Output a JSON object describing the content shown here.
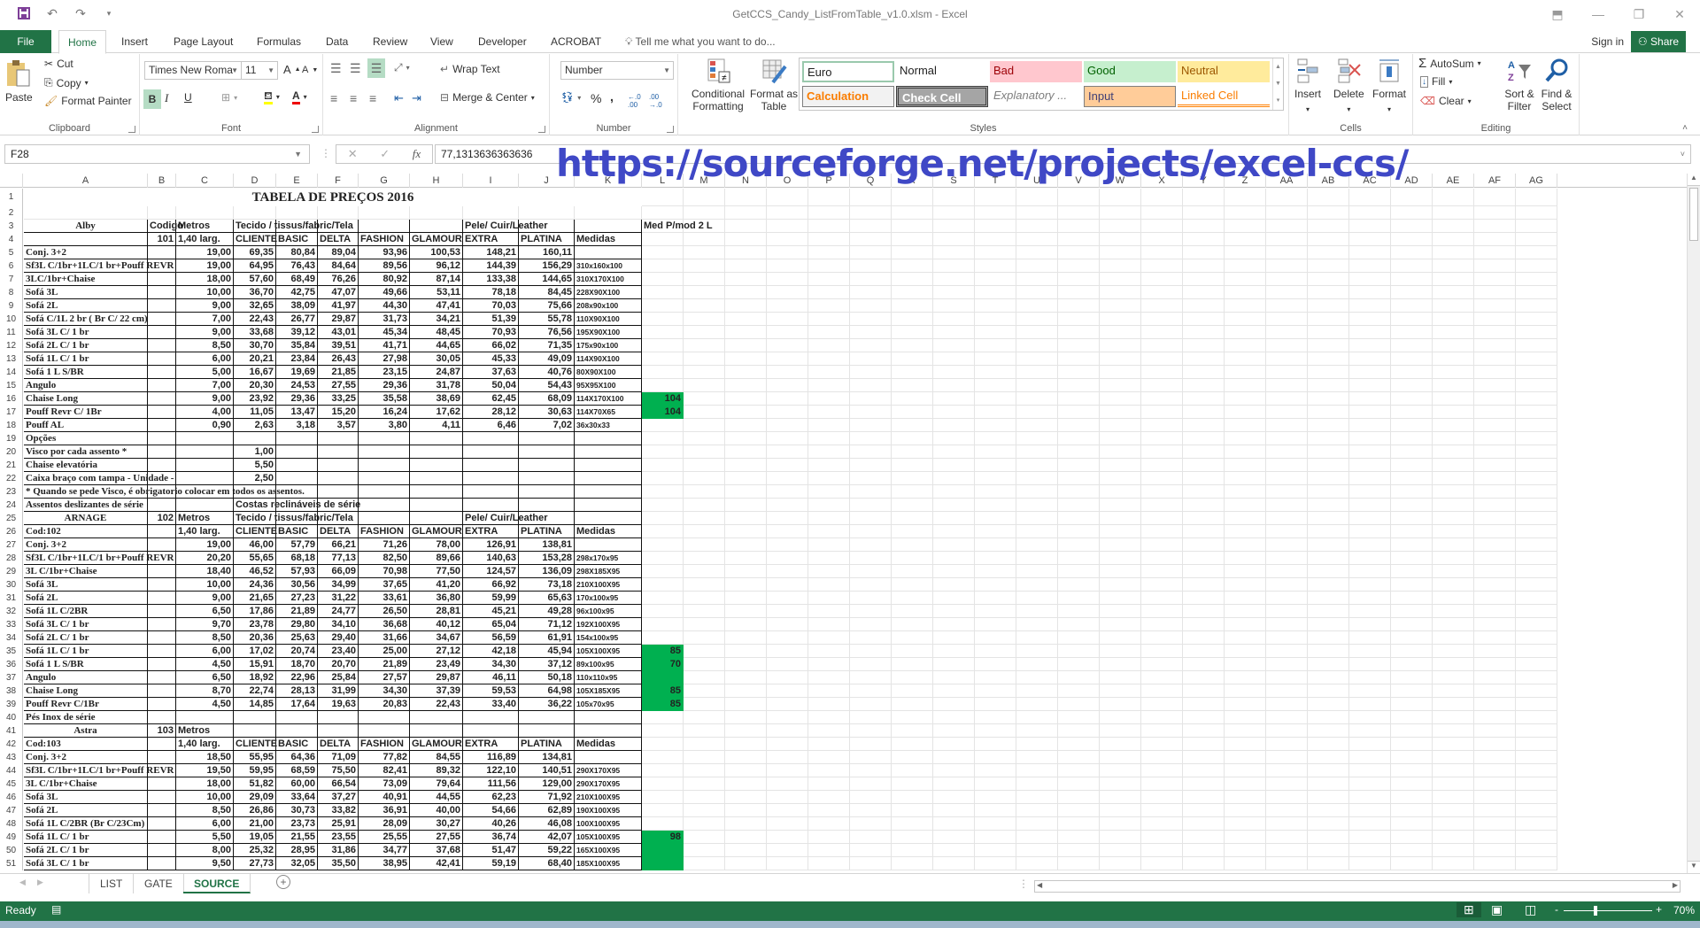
{
  "window": {
    "title": "GetCCS_Candy_ListFromTable_v1.0.xlsm - Excel",
    "controls": [
      "ribbon-display",
      "minimize",
      "restore",
      "close"
    ]
  },
  "ribbon_tabs": [
    {
      "label": "File"
    },
    {
      "label": "Home",
      "active": true
    },
    {
      "label": "Insert"
    },
    {
      "label": "Page Layout"
    },
    {
      "label": "Formulas"
    },
    {
      "label": "Data"
    },
    {
      "label": "Review"
    },
    {
      "label": "View"
    },
    {
      "label": "Developer"
    },
    {
      "label": "ACROBAT"
    }
  ],
  "tell_me": "Tell me what you want to do...",
  "sign_in": "Sign in",
  "share": "Share",
  "clipboard": {
    "paste": "Paste",
    "cut": "Cut",
    "copy": "Copy",
    "format_painter": "Format Painter",
    "label": "Clipboard"
  },
  "font": {
    "name": "Times New Roma",
    "size": "11",
    "bold": "B",
    "italic": "I",
    "underline": "U",
    "label": "Font",
    "grow": "A",
    "shrink": "A"
  },
  "alignment": {
    "wrap_text": "Wrap Text",
    "merge_center": "Merge & Center",
    "label": "Alignment"
  },
  "number": {
    "format": "Number",
    "percent": "%",
    "comma": ",",
    "label": "Number"
  },
  "styles": {
    "conditional_formatting": "Conditional Formatting",
    "format_as_table": "Format as Table",
    "cells": [
      {
        "label": "Euro",
        "bg": "#ffffff",
        "fg": "#000000",
        "border": "#9ac9ad"
      },
      {
        "label": "Normal",
        "bg": "#ffffff",
        "fg": "#000000"
      },
      {
        "label": "Bad",
        "bg": "#ffc7ce",
        "fg": "#9c0006"
      },
      {
        "label": "Good",
        "bg": "#c6efce",
        "fg": "#006100"
      },
      {
        "label": "Neutral",
        "bg": "#ffeb9c",
        "fg": "#9c5700"
      },
      {
        "label": "Calculation",
        "bg": "#f2f2f2",
        "fg": "#fa7d00",
        "border": "#7f7f7f"
      },
      {
        "label": "Check Cell",
        "bg": "#a5a5a5",
        "fg": "#ffffff",
        "border": "#3f3f3f"
      },
      {
        "label": "Explanatory ...",
        "bg": "#ffffff",
        "fg": "#7f7f7f"
      },
      {
        "label": "Input",
        "bg": "#ffcc99",
        "fg": "#3f3f76",
        "border": "#7f7f7f"
      },
      {
        "label": "Linked Cell",
        "bg": "#ffffff",
        "fg": "#fa7d00"
      }
    ],
    "label": "Styles"
  },
  "cells_group": {
    "insert": "Insert",
    "delete": "Delete",
    "format": "Format",
    "label": "Cells"
  },
  "editing": {
    "autosum": "AutoSum",
    "fill": "Fill",
    "clear": "Clear",
    "sort_filter": "Sort & Filter",
    "find_select": "Find & Select",
    "label": "Editing"
  },
  "formula_bar": {
    "name_box": "F28",
    "value": "77,1313636363636",
    "cancel": "✕",
    "enter": "✓",
    "fx": "fx"
  },
  "overlay_url": "https://sourceforge.net/projects/excel-ccs/",
  "columns": [
    "A",
    "B",
    "C",
    "D",
    "E",
    "F",
    "G",
    "H",
    "I",
    "J",
    "K",
    "L",
    "M",
    "N",
    "O",
    "P",
    "Q",
    "R",
    "S",
    "T",
    "U",
    "V",
    "W",
    "X",
    "Y",
    "Z",
    "AA",
    "AB",
    "AC",
    "AD",
    "AE",
    "AF",
    "AG"
  ],
  "sheet": {
    "title": "TABELA DE PREÇOS 2016",
    "rows": [
      {
        "r": 1
      },
      {
        "r": 2
      },
      {
        "r": 3,
        "A": "Alby",
        "B": "Codigo",
        "C": "Metros",
        "D": "Tecido / tissus/fabric/Tela",
        "I": "Pele/ Cuir/Leather",
        "L": "Med P/mod 2 L"
      },
      {
        "r": 4,
        "B": "101",
        "C": "1,40 larg.",
        "D": "CLIENTE",
        "E": "BASIC",
        "F": "DELTA",
        "G": "FASHION",
        "H": "GLAMOUR",
        "I": "EXTRA",
        "J": "PLATINA",
        "K": "Medidas"
      },
      {
        "r": 5,
        "A": "Conj. 3+2",
        "C": "19,00",
        "D": "69,35",
        "E": "80,84",
        "F": "89,04",
        "G": "93,96",
        "H": "100,53",
        "I": "148,21",
        "J": "160,11"
      },
      {
        "r": 6,
        "A": "Sf3L C/1br+1LC/1 br+Pouff REVR",
        "C": "19,00",
        "D": "64,95",
        "E": "76,43",
        "F": "84,64",
        "G": "89,56",
        "H": "96,12",
        "I": "144,39",
        "J": "156,29",
        "K": "310x160x100"
      },
      {
        "r": 7,
        "A": "3LC/1br+Chaise",
        "C": "18,00",
        "D": "57,60",
        "E": "68,49",
        "F": "76,26",
        "G": "80,92",
        "H": "87,14",
        "I": "133,38",
        "J": "144,65",
        "K": "310X170X100"
      },
      {
        "r": 8,
        "A": "Sofá 3L",
        "C": "10,00",
        "D": "36,70",
        "E": "42,75",
        "F": "47,07",
        "G": "49,66",
        "H": "53,11",
        "I": "78,18",
        "J": "84,45",
        "K": "228X90X100"
      },
      {
        "r": 9,
        "A": "Sofá 2L",
        "C": "9,00",
        "D": "32,65",
        "E": "38,09",
        "F": "41,97",
        "G": "44,30",
        "H": "47,41",
        "I": "70,03",
        "J": "75,66",
        "K": "208x90x100"
      },
      {
        "r": 10,
        "A": "Sofá C/1L 2 br ( Br C/ 22 cm)",
        "C": "7,00",
        "D": "22,43",
        "E": "26,77",
        "F": "29,87",
        "G": "31,73",
        "H": "34,21",
        "I": "51,39",
        "J": "55,78",
        "K": "110X90X100"
      },
      {
        "r": 11,
        "A": "Sofá 3L C/ 1 br",
        "C": "9,00",
        "D": "33,68",
        "E": "39,12",
        "F": "43,01",
        "G": "45,34",
        "H": "48,45",
        "I": "70,93",
        "J": "76,56",
        "K": "195X90X100"
      },
      {
        "r": 12,
        "A": "Sofá 2L C/ 1 br",
        "C": "8,50",
        "D": "30,70",
        "E": "35,84",
        "F": "39,51",
        "G": "41,71",
        "H": "44,65",
        "I": "66,02",
        "J": "71,35",
        "K": "175x90x100"
      },
      {
        "r": 13,
        "A": "Sofá 1L C/ 1 br",
        "C": "6,00",
        "D": "20,21",
        "E": "23,84",
        "F": "26,43",
        "G": "27,98",
        "H": "30,05",
        "I": "45,33",
        "J": "49,09",
        "K": "114X90X100"
      },
      {
        "r": 14,
        "A": "Sofá 1 L S/BR",
        "C": "5,00",
        "D": "16,67",
        "E": "19,69",
        "F": "21,85",
        "G": "23,15",
        "H": "24,87",
        "I": "37,63",
        "J": "40,76",
        "K": "80X90X100"
      },
      {
        "r": 15,
        "A": "Angulo",
        "C": "7,00",
        "D": "20,30",
        "E": "24,53",
        "F": "27,55",
        "G": "29,36",
        "H": "31,78",
        "I": "50,04",
        "J": "54,43",
        "K": "95X95X100"
      },
      {
        "r": 16,
        "A": "Chaise Long",
        "C": "9,00",
        "D": "23,92",
        "E": "29,36",
        "F": "33,25",
        "G": "35,58",
        "H": "38,69",
        "I": "62,45",
        "J": "68,09",
        "K": "114X170X100",
        "L": "104"
      },
      {
        "r": 17,
        "A": "Pouff Revr C/ 1Br",
        "C": "4,00",
        "D": "11,05",
        "E": "13,47",
        "F": "15,20",
        "G": "16,24",
        "H": "17,62",
        "I": "28,12",
        "J": "30,63",
        "K": "114X70X65",
        "L": "104"
      },
      {
        "r": 18,
        "A": "Pouff AL",
        "C": "0,90",
        "D": "2,63",
        "E": "3,18",
        "F": "3,57",
        "G": "3,80",
        "H": "4,11",
        "I": "6,46",
        "J": "7,02",
        "K": "36x30x33"
      },
      {
        "r": 19,
        "A": "Opções"
      },
      {
        "r": 20,
        "A": "Visco por cada assento *",
        "D": "1,00"
      },
      {
        "r": 21,
        "A": "Chaise elevatória",
        "D": "5,50"
      },
      {
        "r": 22,
        "A": "Caixa braço com tampa - Unidade -",
        "D": "2,50"
      },
      {
        "r": 23,
        "A": "* Quando se pede Visco, é obrigatorio colocar em todos os assentos."
      },
      {
        "r": 24,
        "A": "Assentos deslizantes de série",
        "D": "Costas reclináveis de série"
      },
      {
        "r": 25,
        "A": "ARNAGE",
        "B": "102",
        "C": "Metros",
        "D": "Tecido / tissus/fabric/Tela",
        "I": "Pele/ Cuir/Leather"
      },
      {
        "r": 26,
        "A": "Cod:102",
        "C": "1,40 larg.",
        "D": "CLIENTE",
        "E": "BASIC",
        "F": "DELTA",
        "G": "FASHION",
        "H": "GLAMOUR",
        "I": "EXTRA",
        "J": "PLATINA",
        "K": "Medidas"
      },
      {
        "r": 27,
        "A": "Conj. 3+2",
        "C": "19,00",
        "D": "46,00",
        "E": "57,79",
        "F": "66,21",
        "G": "71,26",
        "H": "78,00",
        "I": "126,91",
        "J": "138,81"
      },
      {
        "r": 28,
        "A": "Sf3L C/1br+1LC/1 br+Pouff REVR",
        "C": "20,20",
        "D": "55,65",
        "E": "68,18",
        "F": "77,13",
        "G": "82,50",
        "H": "89,66",
        "I": "140,63",
        "J": "153,28",
        "K": "298x170x95"
      },
      {
        "r": 29,
        "A": "3L C/1br+Chaise",
        "C": "18,40",
        "D": "46,52",
        "E": "57,93",
        "F": "66,09",
        "G": "70,98",
        "H": "77,50",
        "I": "124,57",
        "J": "136,09",
        "K": "298X185X95"
      },
      {
        "r": 30,
        "A": "Sofá 3L",
        "C": "10,00",
        "D": "24,36",
        "E": "30,56",
        "F": "34,99",
        "G": "37,65",
        "H": "41,20",
        "I": "66,92",
        "J": "73,18",
        "K": "210X100X95"
      },
      {
        "r": 31,
        "A": "Sofá 2L",
        "C": "9,00",
        "D": "21,65",
        "E": "27,23",
        "F": "31,22",
        "G": "33,61",
        "H": "36,80",
        "I": "59,99",
        "J": "65,63",
        "K": "170x100x95"
      },
      {
        "r": 32,
        "A": "Sofá 1L C/2BR",
        "C": "6,50",
        "D": "17,86",
        "E": "21,89",
        "F": "24,77",
        "G": "26,50",
        "H": "28,81",
        "I": "45,21",
        "J": "49,28",
        "K": "96x100x95"
      },
      {
        "r": 33,
        "A": "Sofá 3L C/ 1 br",
        "C": "9,70",
        "D": "23,78",
        "E": "29,80",
        "F": "34,10",
        "G": "36,68",
        "H": "40,12",
        "I": "65,04",
        "J": "71,12",
        "K": "192X100X95"
      },
      {
        "r": 34,
        "A": "Sofá 2L C/ 1 br",
        "C": "8,50",
        "D": "20,36",
        "E": "25,63",
        "F": "29,40",
        "G": "31,66",
        "H": "34,67",
        "I": "56,59",
        "J": "61,91",
        "K": "154x100x95"
      },
      {
        "r": 35,
        "A": "Sofá 1L C/ 1 br",
        "C": "6,00",
        "D": "17,02",
        "E": "20,74",
        "F": "23,40",
        "G": "25,00",
        "H": "27,12",
        "I": "42,18",
        "J": "45,94",
        "K": "105X100X95",
        "L": "85"
      },
      {
        "r": 36,
        "A": "Sofá 1 L S/BR",
        "C": "4,50",
        "D": "15,91",
        "E": "18,70",
        "F": "20,70",
        "G": "21,89",
        "H": "23,49",
        "I": "34,30",
        "J": "37,12",
        "K": "89x100x95",
        "L": "70"
      },
      {
        "r": 37,
        "A": "Angulo",
        "C": "6,50",
        "D": "18,92",
        "E": "22,96",
        "F": "25,84",
        "G": "27,57",
        "H": "29,87",
        "I": "46,11",
        "J": "50,18",
        "K": "110x110x95",
        "L": ""
      },
      {
        "r": 38,
        "A": "Chaise Long",
        "C": "8,70",
        "D": "22,74",
        "E": "28,13",
        "F": "31,99",
        "G": "34,30",
        "H": "37,39",
        "I": "59,53",
        "J": "64,98",
        "K": "105X185X95",
        "L": "85"
      },
      {
        "r": 39,
        "A": "Pouff Revr C/1Br",
        "C": "4,50",
        "D": "14,85",
        "E": "17,64",
        "F": "19,63",
        "G": "20,83",
        "H": "22,43",
        "I": "33,40",
        "J": "36,22",
        "K": "105x70x95",
        "L": "85"
      },
      {
        "r": 40,
        "A": "Pés Inox de série"
      },
      {
        "r": 41,
        "A": "Astra",
        "B": "103",
        "C": "Metros"
      },
      {
        "r": 42,
        "A": "Cod:103",
        "C": "1,40 larg.",
        "D": "CLIENTE",
        "E": "BASIC",
        "F": "DELTA",
        "G": "FASHION",
        "H": "GLAMOUR",
        "I": "EXTRA",
        "J": "PLATINA",
        "K": "Medidas"
      },
      {
        "r": 43,
        "A": "Conj. 3+2",
        "C": "18,50",
        "D": "55,95",
        "E": "64,36",
        "F": "71,09",
        "G": "77,82",
        "H": "84,55",
        "I": "116,89",
        "J": "134,81"
      },
      {
        "r": 44,
        "A": "Sf3L C/1br+1LC/1 br+Pouff REVR",
        "C": "19,50",
        "D": "59,95",
        "E": "68,59",
        "F": "75,50",
        "G": "82,41",
        "H": "89,32",
        "I": "122,10",
        "J": "140,51",
        "K": "290X170X95"
      },
      {
        "r": 45,
        "A": "3L C/1br+Chaise",
        "C": "18,00",
        "D": "51,82",
        "E": "60,00",
        "F": "66,54",
        "G": "73,09",
        "H": "79,64",
        "I": "111,56",
        "J": "129,00",
        "K": "290X170X95"
      },
      {
        "r": 46,
        "A": "Sofá 3L",
        "C": "10,00",
        "D": "29,09",
        "E": "33,64",
        "F": "37,27",
        "G": "40,91",
        "H": "44,55",
        "I": "62,23",
        "J": "71,92",
        "K": "210X100X95"
      },
      {
        "r": 47,
        "A": "Sofá 2L",
        "C": "8,50",
        "D": "26,86",
        "E": "30,73",
        "F": "33,82",
        "G": "36,91",
        "H": "40,00",
        "I": "54,66",
        "J": "62,89",
        "K": "190X100X95"
      },
      {
        "r": 48,
        "A": "Sofá 1L C/2BR (Br C/23Cm)",
        "C": "6,00",
        "D": "21,00",
        "E": "23,73",
        "F": "25,91",
        "G": "28,09",
        "H": "30,27",
        "I": "40,26",
        "J": "46,08",
        "K": "100X100X95"
      },
      {
        "r": 49,
        "A": "Sofá 1L C/ 1 br",
        "C": "5,50",
        "D": "19,05",
        "E": "21,55",
        "F": "23,55",
        "G": "25,55",
        "H": "27,55",
        "I": "36,74",
        "J": "42,07",
        "K": "105X100X95",
        "L": "98"
      },
      {
        "r": 50,
        "A": "Sofá 2L C/ 1 br",
        "C": "8,00",
        "D": "25,32",
        "E": "28,95",
        "F": "31,86",
        "G": "34,77",
        "H": "37,68",
        "I": "51,47",
        "J": "59,22",
        "K": "165X100X95",
        "L": ""
      },
      {
        "r": 51,
        "A": "Sofá 3L C/ 1 br",
        "C": "9,50",
        "D": "27,73",
        "E": "32,05",
        "F": "35,50",
        "G": "38,95",
        "H": "42,41",
        "I": "59,19",
        "J": "68,40",
        "K": "185X100X95",
        "L": ""
      }
    ],
    "green_cells": [
      "L16",
      "L17",
      "L35",
      "L36",
      "L37",
      "L38",
      "L39",
      "L49",
      "L50",
      "L51"
    ]
  },
  "sheet_tabs": [
    {
      "label": "LIST"
    },
    {
      "label": "GATE"
    },
    {
      "label": "SOURCE",
      "active": true
    }
  ],
  "status": {
    "ready": "Ready",
    "zoom": "70%",
    "zoom_minus": "-",
    "zoom_plus": "+"
  },
  "colors": {
    "excel_green": "#217346",
    "highlight_green": "#00b050",
    "url_blue": "#3f48c6"
  }
}
